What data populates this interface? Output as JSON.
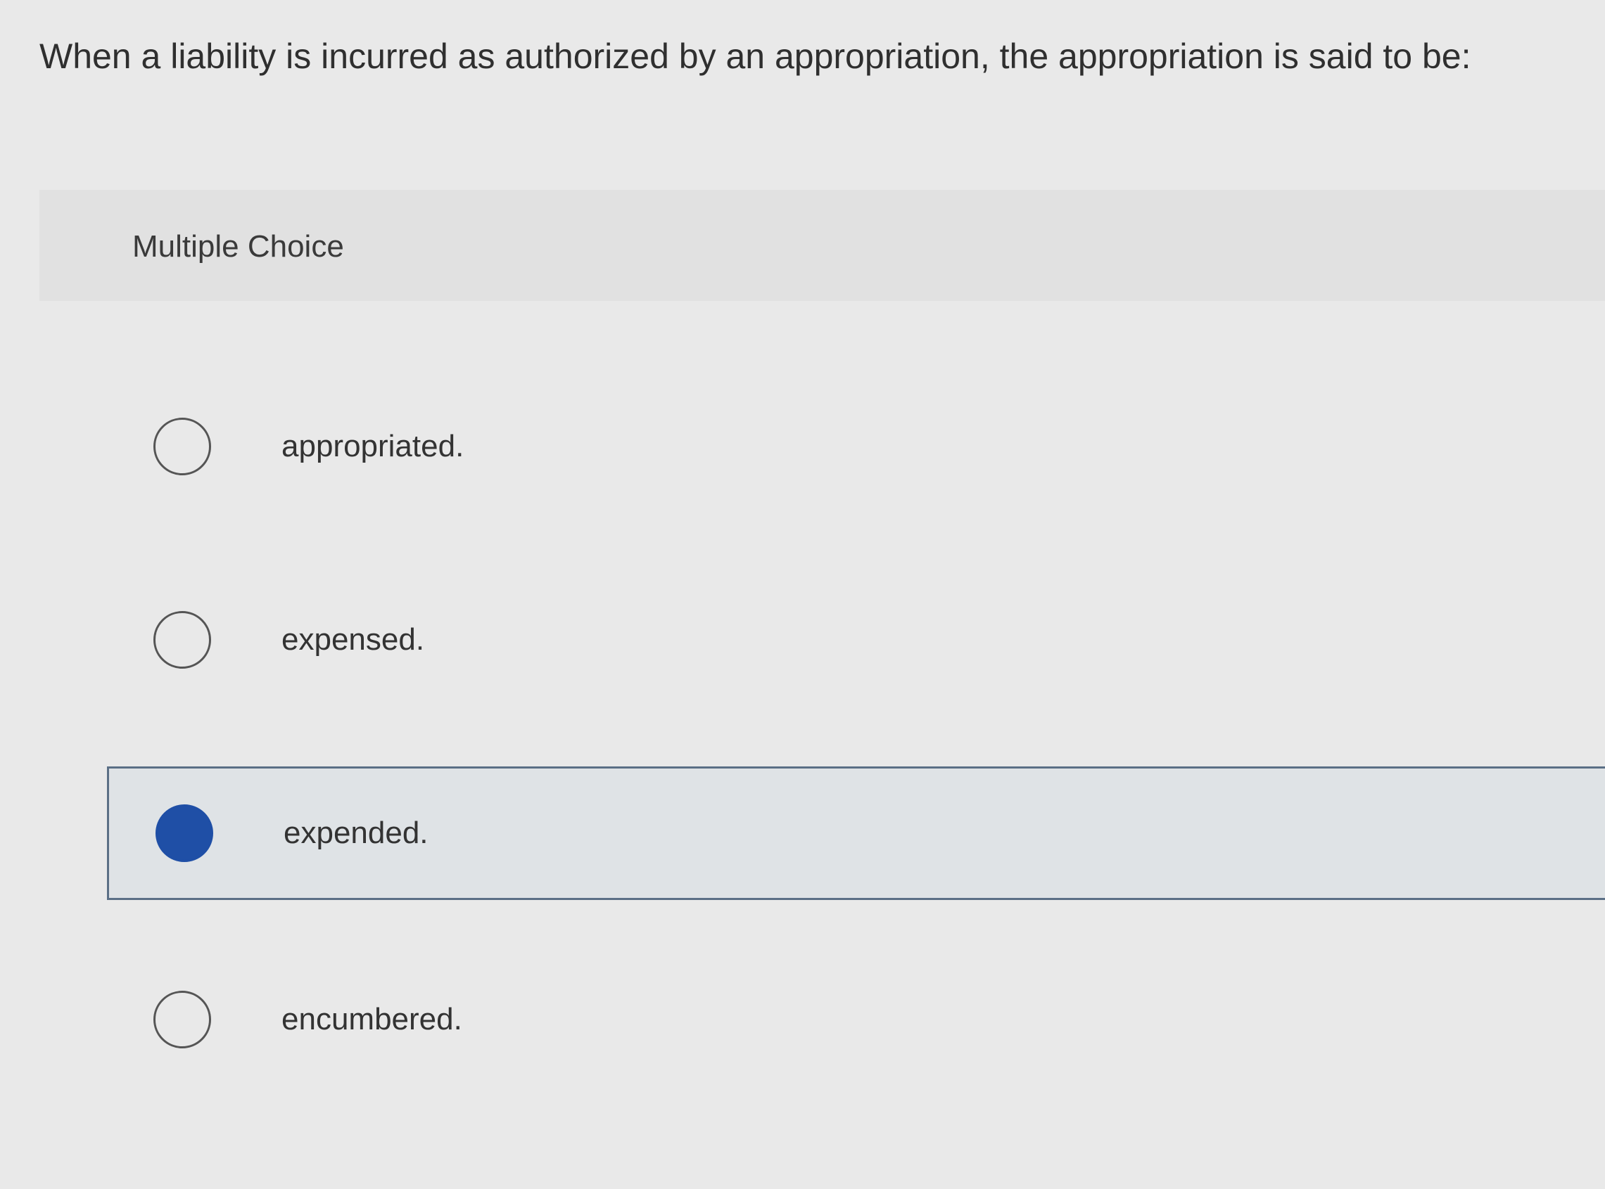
{
  "question": {
    "text": "When a liability is incurred as authorized by an appropriation, the appropriation is said to be:"
  },
  "section": {
    "label": "Multiple Choice"
  },
  "options": [
    {
      "label": "appropriated.",
      "selected": false
    },
    {
      "label": "expensed.",
      "selected": false
    },
    {
      "label": "expended.",
      "selected": true
    },
    {
      "label": "encumbered.",
      "selected": false
    }
  ],
  "colors": {
    "selected_radio": "#1f4fa6",
    "selected_border": "#5b6f86",
    "selected_background": "#dfe3e6"
  }
}
